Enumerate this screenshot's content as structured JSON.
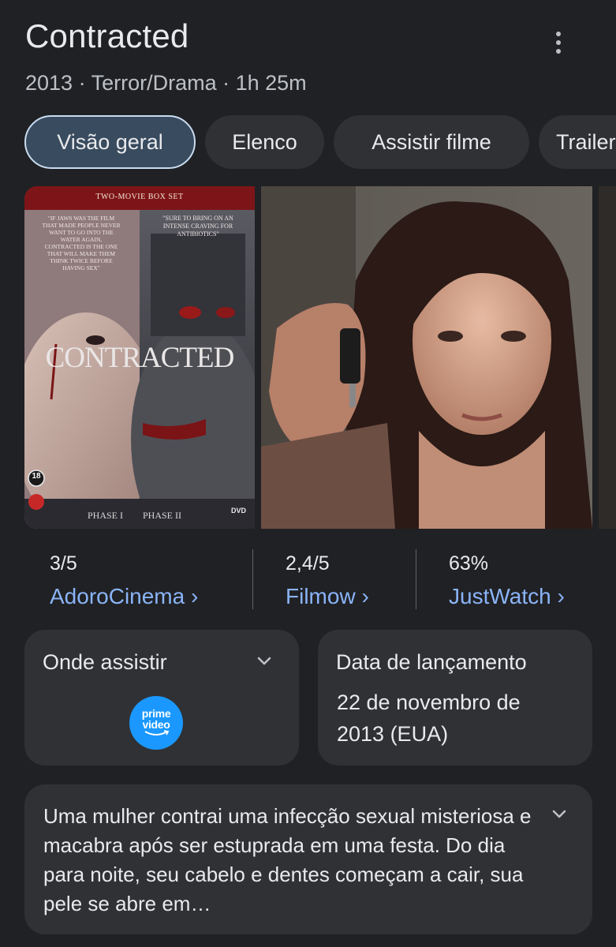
{
  "header": {
    "title": "Contracted",
    "subtitle": "2013 · Terror/Drama · 1h 25m"
  },
  "tabs": [
    {
      "label": "Visão geral",
      "active": true
    },
    {
      "label": "Elenco",
      "active": false
    },
    {
      "label": "Assistir filme",
      "active": false
    },
    {
      "label": "Trailer",
      "active": false
    }
  ],
  "poster": {
    "box_set": "TWO-MOVIE BOX SET",
    "quote_left": "\"IF JAWS WAS THE FILM THAT MADE PEOPLE NEVER WANT TO GO INTO THE WATER AGAIN, CONTRACTED IS THE ONE THAT WILL MAKE THEM THINK TWICE BEFORE HAVING SEX\"",
    "quote_right": "\"SURE TO BRING ON AN INTENSE CRAVING FOR ANTIBIOTICS\"",
    "title": "CONTRACTED",
    "phase1": "PHASE I",
    "phase2": "PHASE II",
    "rating_badge": "18",
    "format": "DVD"
  },
  "ratings": [
    {
      "score": "3/5",
      "source": "AdoroCinema ›"
    },
    {
      "score": "2,4/5",
      "source": "Filmow ›"
    },
    {
      "score": "63%",
      "source": "JustWatch ›"
    }
  ],
  "where_to_watch": {
    "title": "Onde assistir",
    "provider_line1": "prime",
    "provider_line2": "video"
  },
  "release": {
    "title": "Data de lançamento",
    "date": "22 de novembro de 2013 (EUA)"
  },
  "description": "Uma mulher contrai uma infecção sexual misteriosa e macabra após ser estuprada em uma festa. Do dia para noite, seu cabelo e dentes começam a cair, sua pele se abre em…",
  "colors": {
    "background": "#202124",
    "card": "#303134",
    "link": "#8ab4f8",
    "active_tab": "#394b5e",
    "prime_blue": "#1a98ff"
  }
}
